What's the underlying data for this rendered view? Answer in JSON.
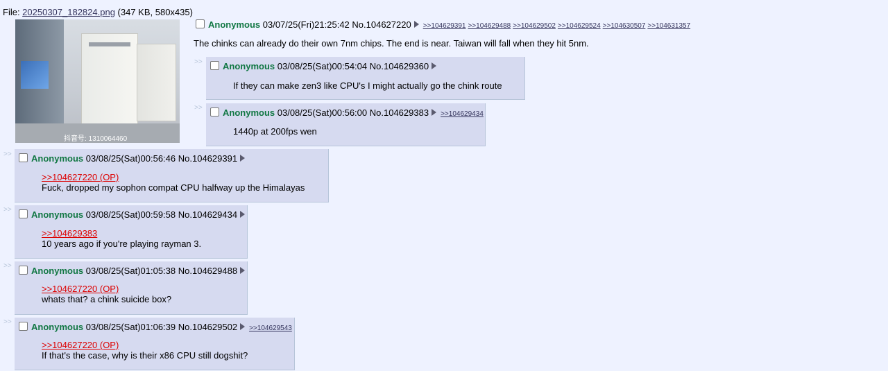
{
  "file": {
    "prefix": "File: ",
    "name": "20250307_182824.png",
    "meta": " (347 KB, 580x435)",
    "watermark": "抖音号: 1310064460"
  },
  "op": {
    "name": "Anonymous",
    "date": "03/07/25(Fri)21:25:42",
    "no": "No.104627220",
    "backlinks": [
      ">>104629391",
      ">>104629488",
      ">>104629502",
      ">>104629524",
      ">>104630507",
      ">>104631357"
    ],
    "text": "The chinks can already do their own 7nm chips. The end is near. Taiwan will fall when they hit 5nm."
  },
  "replies": [
    {
      "name": "Anonymous",
      "date": "03/08/25(Sat)00:54:04",
      "no": "No.104629360",
      "backlink": "",
      "quote": "",
      "text": "If they can make zen3 like CPU's I might actually go the chink route"
    },
    {
      "name": "Anonymous",
      "date": "03/08/25(Sat)00:56:00",
      "no": "No.104629383",
      "backlink": ">>104629434",
      "quote": "",
      "text": "1440p at 200fps wen"
    },
    {
      "name": "Anonymous",
      "date": "03/08/25(Sat)00:56:46",
      "no": "No.104629391",
      "backlink": "",
      "quote": ">>104627220 (OP)",
      "text": "Fuck, dropped my sophon compat CPU halfway up the Himalayas"
    },
    {
      "name": "Anonymous",
      "date": "03/08/25(Sat)00:59:58",
      "no": "No.104629434",
      "backlink": "",
      "quote": ">>104629383",
      "text": "10 years ago if you're playing rayman 3."
    },
    {
      "name": "Anonymous",
      "date": "03/08/25(Sat)01:05:38",
      "no": "No.104629488",
      "backlink": "",
      "quote": ">>104627220 (OP)",
      "text": "whats that? a chink suicide box?"
    },
    {
      "name": "Anonymous",
      "date": "03/08/25(Sat)01:06:39",
      "no": "No.104629502",
      "backlink": ">>104629543",
      "quote": ">>104627220 (OP)",
      "text": "If that's the case, why is their x86 CPU still dogshit?"
    }
  ],
  "side_marker": ">>"
}
